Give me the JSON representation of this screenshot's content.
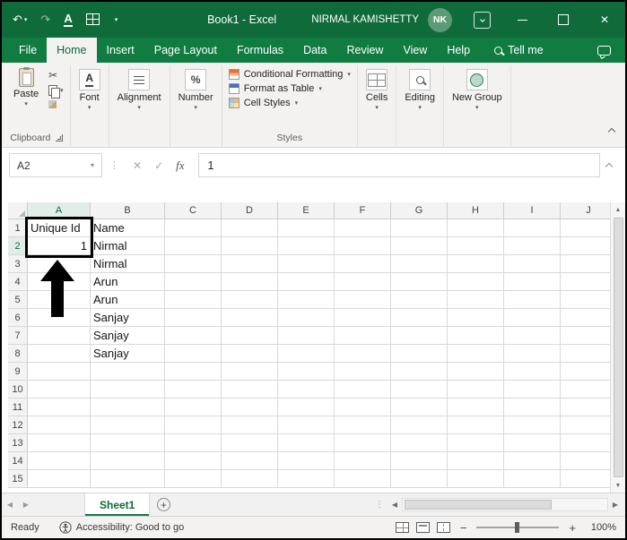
{
  "titlebar": {
    "title": "Book1 - Excel",
    "user_name": "NIRMAL KAMISHETTY",
    "avatar": "NK"
  },
  "tabs": {
    "items": [
      "File",
      "Home",
      "Insert",
      "Page Layout",
      "Formulas",
      "Data",
      "Review",
      "View",
      "Help"
    ],
    "active": "Home",
    "tell_me": "Tell me"
  },
  "ribbon": {
    "paste_label": "Paste",
    "clipboard_group_label": "Clipboard",
    "font_label": "Font",
    "alignment_label": "Alignment",
    "number_label": "Number",
    "styles_items": [
      "Conditional Formatting",
      "Format as Table",
      "Cell Styles"
    ],
    "styles_group_label": "Styles",
    "cells_label": "Cells",
    "editing_label": "Editing",
    "new_group_label": "New Group"
  },
  "formula_bar": {
    "name_box_value": "A2",
    "fx_label": "fx",
    "formula_value": "1"
  },
  "grid": {
    "columns": [
      "A",
      "B",
      "C",
      "D",
      "E",
      "F",
      "G",
      "H",
      "I",
      "J"
    ],
    "rows": [
      "1",
      "2",
      "3",
      "4",
      "5",
      "6",
      "7",
      "8",
      "9",
      "10",
      "11",
      "12",
      "13",
      "14",
      "15"
    ],
    "cells": {
      "A1": {
        "text": "Unique Id"
      },
      "B1": {
        "text": "Name"
      },
      "A2": {
        "text": "1",
        "align": "right"
      },
      "B2": {
        "text": "Nirmal"
      },
      "B3": {
        "text": "Nirmal"
      },
      "B4": {
        "text": "Arun"
      },
      "B5": {
        "text": "Arun"
      },
      "B6": {
        "text": "Sanjay"
      },
      "B7": {
        "text": "Sanjay"
      },
      "B8": {
        "text": "Sanjay"
      }
    },
    "selected_cell": "A2",
    "selected_column": "A",
    "selected_row": "2"
  },
  "sheet_bar": {
    "sheet_tab": "Sheet1"
  },
  "status_bar": {
    "mode": "Ready",
    "accessibility": "Accessibility: Good to go",
    "zoom_out_label": "−",
    "zoom_in_label": "+",
    "zoom_level": "100%"
  },
  "colors": {
    "excel_green": "#107C41",
    "title_bar_green": "#0F6B3A",
    "annotation_color": "#000000"
  }
}
